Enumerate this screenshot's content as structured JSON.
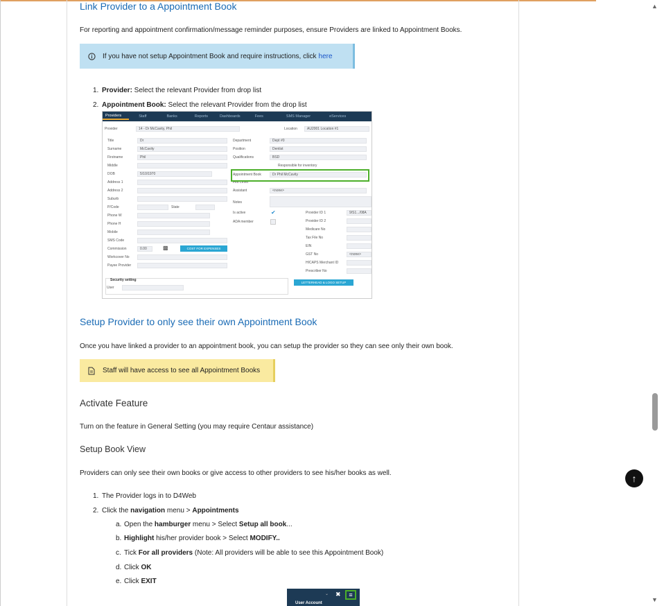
{
  "section1": {
    "title": "Link Provider to a Appointment Book",
    "intro": "For reporting and appointment confirmation/message reminder purposes, ensure Providers are linked to Appointment Books.",
    "info_text": "If you have not setup Appointment Book and require instructions, click ",
    "info_link": "here",
    "steps": [
      {
        "num": "1.",
        "bold": "Provider:",
        "text": " Select the relevant Provider from drop list"
      },
      {
        "num": "2.",
        "bold": "Appointment Book:",
        "text": "  Select the relevant Provider from the drop list"
      }
    ]
  },
  "app": {
    "tabs": [
      "Providers",
      "Staff",
      "Banks",
      "Reports",
      "Dashboards",
      "Fees",
      "SMS Manager",
      "eServices"
    ],
    "provider_label": "Provider",
    "provider_value": "14 - Dr McCavity, Phil",
    "location_label": "Location",
    "location_value": "AU2001 Location #1",
    "left_labels": [
      "Title",
      "Surname",
      "Firstname",
      "Middle",
      "DOB",
      "Address 1",
      "Address 2",
      "Suburb",
      "P/Code",
      "Phone W",
      "Phone H",
      "Mobile",
      "SMS Code",
      "Commission",
      "Workcover No",
      "Payee Provider"
    ],
    "title_value": "Dr",
    "surname_value": "McCavity",
    "firstname_value": "Phil",
    "dob_value": "5/10/1970",
    "state_label": "State",
    "commission_value": "0.00",
    "cost_button": "COST FOR EXPENSES",
    "mid_labels": [
      "Department",
      "Position",
      "Qualifications",
      "",
      "Appointment Book",
      "Fee Level",
      "Assistant",
      "Notes",
      "Is active",
      "ADA member"
    ],
    "department_value": "Dept #0",
    "position_value": "Dentist",
    "qualifications_value": "BSD",
    "responsible_label": "Responsible for inventory",
    "appt_book_value": "Dr Phil McCavity",
    "assistant_value": "<none>",
    "right_labels": [
      "Provider ID 1",
      "Provider ID 2",
      "Medicare No",
      "Tax File No",
      "EIN",
      "GST No",
      "HICAPS Merchant ID",
      "Prescriber No"
    ],
    "provider_id1_value": "9/S1.../08A",
    "gst_value": "<none>",
    "letterhead_button": "LETTERHEAD & LOGO SETUP",
    "security_label": "Security setting",
    "user_label": "User"
  },
  "section2": {
    "title": "Setup Provider to only see their own Appointment Book",
    "intro": "Once you have linked a provider to an appointment book, you can setup the provider so they can see only their own book.",
    "note_text": "Staff will have access to see all Appointment Books"
  },
  "section3": {
    "title": "Activate Feature",
    "text": "Turn on the feature in General Setting (you may require Centaur assistance)"
  },
  "section4": {
    "title": "Setup Book View",
    "text": "Providers can only see their own books or give access to other providers to see his/her books as well.",
    "step1": {
      "num": "1.",
      "text": "The Provider logs in to D4Web"
    },
    "step2": {
      "num": "2.",
      "pre": "Click the ",
      "bold": "navigation",
      "mid": " menu >  ",
      "bold2": "Appointments"
    },
    "substeps": [
      {
        "num": "a.",
        "pre": "Open the ",
        "bold": "hamburger",
        "mid": " menu > Select ",
        "bold2": "Setup all book",
        "post": "..."
      },
      {
        "num": "b.",
        "pre": "",
        "bold": "Highlight",
        "mid": " his/her provider book > Select ",
        "bold2": "MODIFY..",
        "post": ""
      },
      {
        "num": "c.",
        "pre": "Tick ",
        "bold": "For all providers",
        "mid": " (Note: All providers will be able to see this Appointment Book)",
        "bold2": "",
        "post": ""
      },
      {
        "num": "d.",
        "pre": "Click ",
        "bold": "OK",
        "mid": "",
        "bold2": "",
        "post": ""
      },
      {
        "num": "e.",
        "pre": "Click ",
        "bold": "EXIT",
        "mid": "",
        "bold2": "",
        "post": ""
      }
    ]
  },
  "mini": {
    "caption": "User Account"
  },
  "colors": {
    "heading": "#1a6bb5",
    "info_bg": "#bfe0f2",
    "note_bg": "#faeaa0",
    "highlight": "#4caf2a"
  }
}
